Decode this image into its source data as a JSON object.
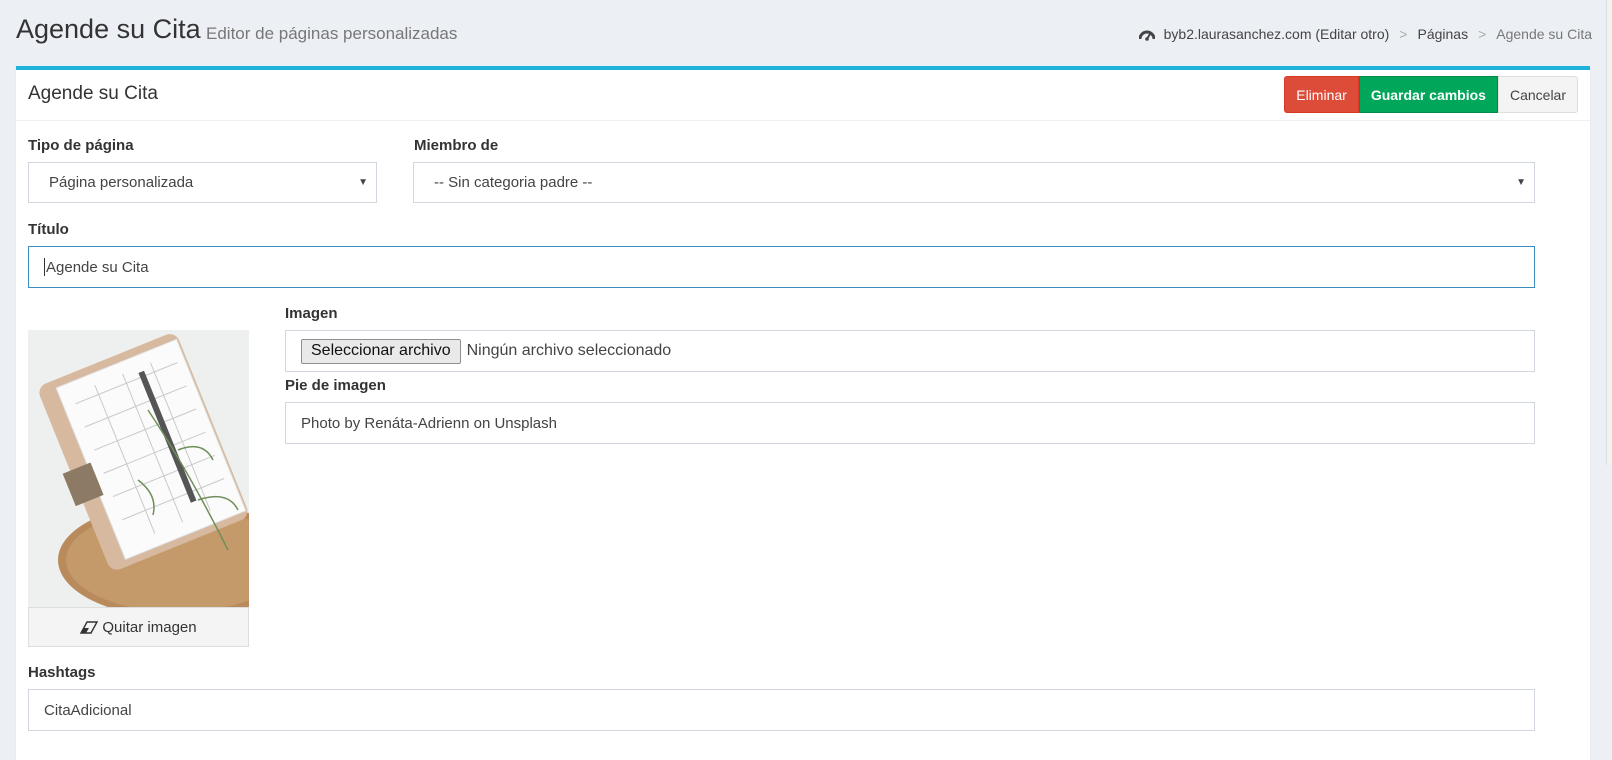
{
  "header": {
    "title": "Agende su Cita",
    "subtitle": "Editor de páginas personalizadas",
    "breadcrumb": {
      "site": "byb2.laurasanchez.com (Editar otro)",
      "sep1": ">",
      "section": "Páginas",
      "sep2": ">",
      "current": "Agende su Cita"
    }
  },
  "box": {
    "title": "Agende su Cita",
    "buttons": {
      "delete": "Eliminar",
      "save": "Guardar cambios",
      "cancel": "Cancelar"
    }
  },
  "form": {
    "page_type": {
      "label": "Tipo de página",
      "value": "Página personalizada"
    },
    "parent": {
      "label": "Miembro de",
      "value": "-- Sin categoria padre --"
    },
    "title": {
      "label": "Título",
      "value": "Agende su Cita"
    },
    "image": {
      "label": "Imagen",
      "file_button": "Seleccionar archivo",
      "file_status": "Ningún archivo seleccionado",
      "remove_label": "Quitar imagen"
    },
    "caption": {
      "label": "Pie de imagen",
      "value": "Photo by Renáta-Adrienn on Unsplash"
    },
    "hashtags": {
      "label": "Hashtags",
      "value": "CitaAdicional"
    }
  },
  "colors": {
    "accent": "#1fb3dc",
    "danger": "#dd4b39",
    "success": "#00a65a",
    "background": "#ecf0f5"
  },
  "icons": [
    "dashboard-icon",
    "eraser-icon",
    "caret-down-icon"
  ]
}
